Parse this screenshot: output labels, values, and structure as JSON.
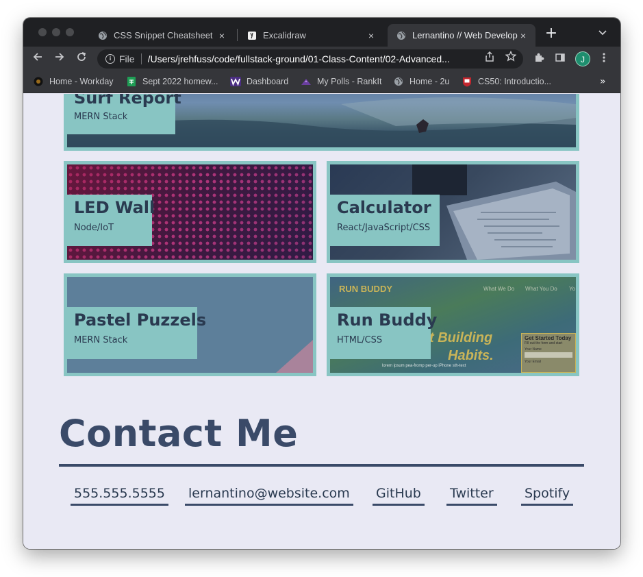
{
  "browser": {
    "tabs": [
      {
        "label": "CSS Snippet Cheatsheet",
        "icon": "globe-icon",
        "active": false
      },
      {
        "label": "Excalidraw",
        "icon": "excalidraw-icon",
        "active": false
      },
      {
        "label": "Lernantino // Web Develope",
        "icon": "globe-icon",
        "active": true
      }
    ],
    "new_tab": "+",
    "close_glyph": "×",
    "address": {
      "scheme": "File",
      "url": "/Users/jrehfuss/code/fullstack-ground/01-Class-Content/02-Advanced..."
    },
    "profile_initial": "J",
    "bookmarks": [
      {
        "label": "Home - Workday",
        "icon": "workday-icon"
      },
      {
        "label": "Sept 2022 homew...",
        "icon": "sheets-icon"
      },
      {
        "label": "Dashboard",
        "icon": "w-icon"
      },
      {
        "label": "My Polls - RankIt",
        "icon": "rankit-icon"
      },
      {
        "label": "Home - 2u",
        "icon": "globe-icon"
      },
      {
        "label": "CS50: Introductio...",
        "icon": "harvard-icon"
      }
    ],
    "bookmarks_more": "»"
  },
  "projects": [
    {
      "title": "Surf Report",
      "subtitle": "MERN Stack"
    },
    {
      "title": "LED Wall",
      "subtitle": "Node/IoT"
    },
    {
      "title": "Calculator",
      "subtitle": "React/JavaScript/CSS"
    },
    {
      "title": "Pastel Puzzels",
      "subtitle": "MERN Stack"
    },
    {
      "title": "Run Buddy",
      "subtitle": "HTML/CSS"
    }
  ],
  "run_buddy_screenshot": {
    "logo": "RUN BUDDY",
    "nav": [
      "What We Do",
      "What You Do",
      "Yo"
    ],
    "hero_line1": "t Building",
    "hero_line2": "Habits.",
    "form_title": "Get Started Today",
    "form_sub": "Fill out the form and start",
    "field1": "Your Name",
    "field2": "Your Email",
    "caption": "lorem ipsum pea-fromp per-up iPhone sth-text"
  },
  "contact": {
    "heading": "Contact Me",
    "links": [
      {
        "label": "555.555.5555"
      },
      {
        "label": "lernantino@website.com"
      },
      {
        "label": "GitHub"
      },
      {
        "label": "Twitter"
      },
      {
        "label": "Spotify"
      }
    ]
  },
  "colors": {
    "accent_teal": "#88c5c3",
    "heading_navy": "#3a4a68",
    "page_bg": "#e9e9f4"
  }
}
